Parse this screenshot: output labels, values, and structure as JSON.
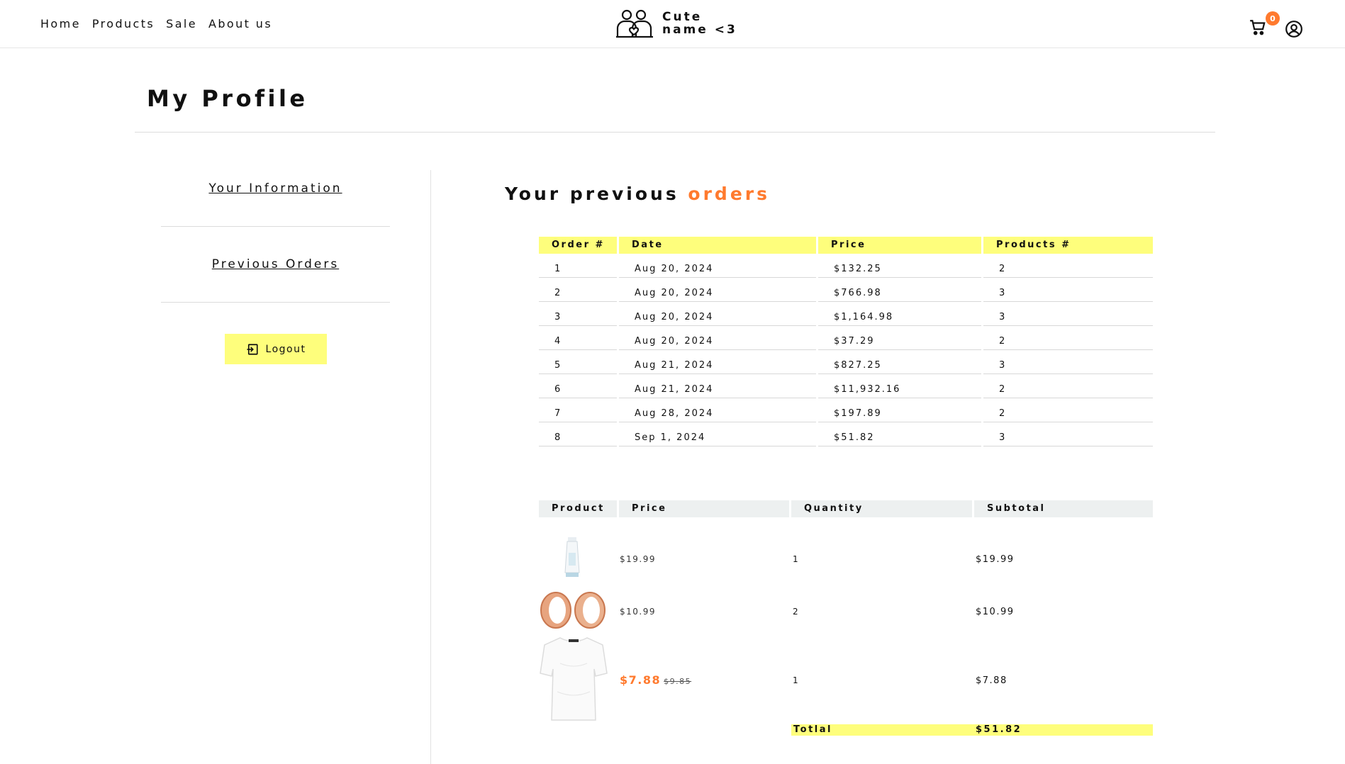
{
  "nav": {
    "items": [
      "Home",
      "Products",
      "Sale",
      "About us"
    ]
  },
  "brand": {
    "line1": "Cute",
    "line2": "name <3",
    "icon": "couple-heart-icon"
  },
  "header": {
    "cart_count": "0",
    "cart_icon": "cart-icon",
    "account_icon": "user-circle-icon"
  },
  "page": {
    "title": "My Profile"
  },
  "sidebar": {
    "items": [
      "Your Information",
      "Previous Orders"
    ],
    "logout_label": "Logout"
  },
  "orders_section": {
    "title_prefix": "Your previous ",
    "title_accent": "orders",
    "columns": [
      "Order #",
      "Date",
      "Price",
      "Products #"
    ],
    "rows": [
      [
        "1",
        "Aug 20, 2024",
        "$132.25",
        "2"
      ],
      [
        "2",
        "Aug 20, 2024",
        "$766.98",
        "3"
      ],
      [
        "3",
        "Aug 20, 2024",
        "$1,164.98",
        "3"
      ],
      [
        "4",
        "Aug 20, 2024",
        "$37.29",
        "2"
      ],
      [
        "5",
        "Aug 21, 2024",
        "$827.25",
        "3"
      ],
      [
        "6",
        "Aug 21, 2024",
        "$11,932.16",
        "2"
      ],
      [
        "7",
        "Aug 28, 2024",
        "$197.89",
        "2"
      ],
      [
        "8",
        "Sep 1, 2024",
        "$51.82",
        "3"
      ]
    ]
  },
  "order_detail": {
    "columns": [
      "Product",
      "Price",
      "Quantity",
      "Subtotal"
    ],
    "items": [
      {
        "image": "cream-tube-image",
        "price": "$19.99",
        "quantity": "1",
        "subtotal": "$19.99"
      },
      {
        "image": "rose-gold-rings-image",
        "price": "$10.99",
        "quantity": "2",
        "subtotal": "$10.99"
      },
      {
        "image": "white-tshirt-image",
        "sale_price": "$7.88",
        "old_price": "$9.85",
        "quantity": "1",
        "subtotal": "$7.88"
      }
    ],
    "total_label": "Totlal",
    "total_value": "$51.82"
  },
  "colors": {
    "accent": "#ff7a2e",
    "highlight": "#fefe7c",
    "table_head_gray": "#edf0f0"
  }
}
